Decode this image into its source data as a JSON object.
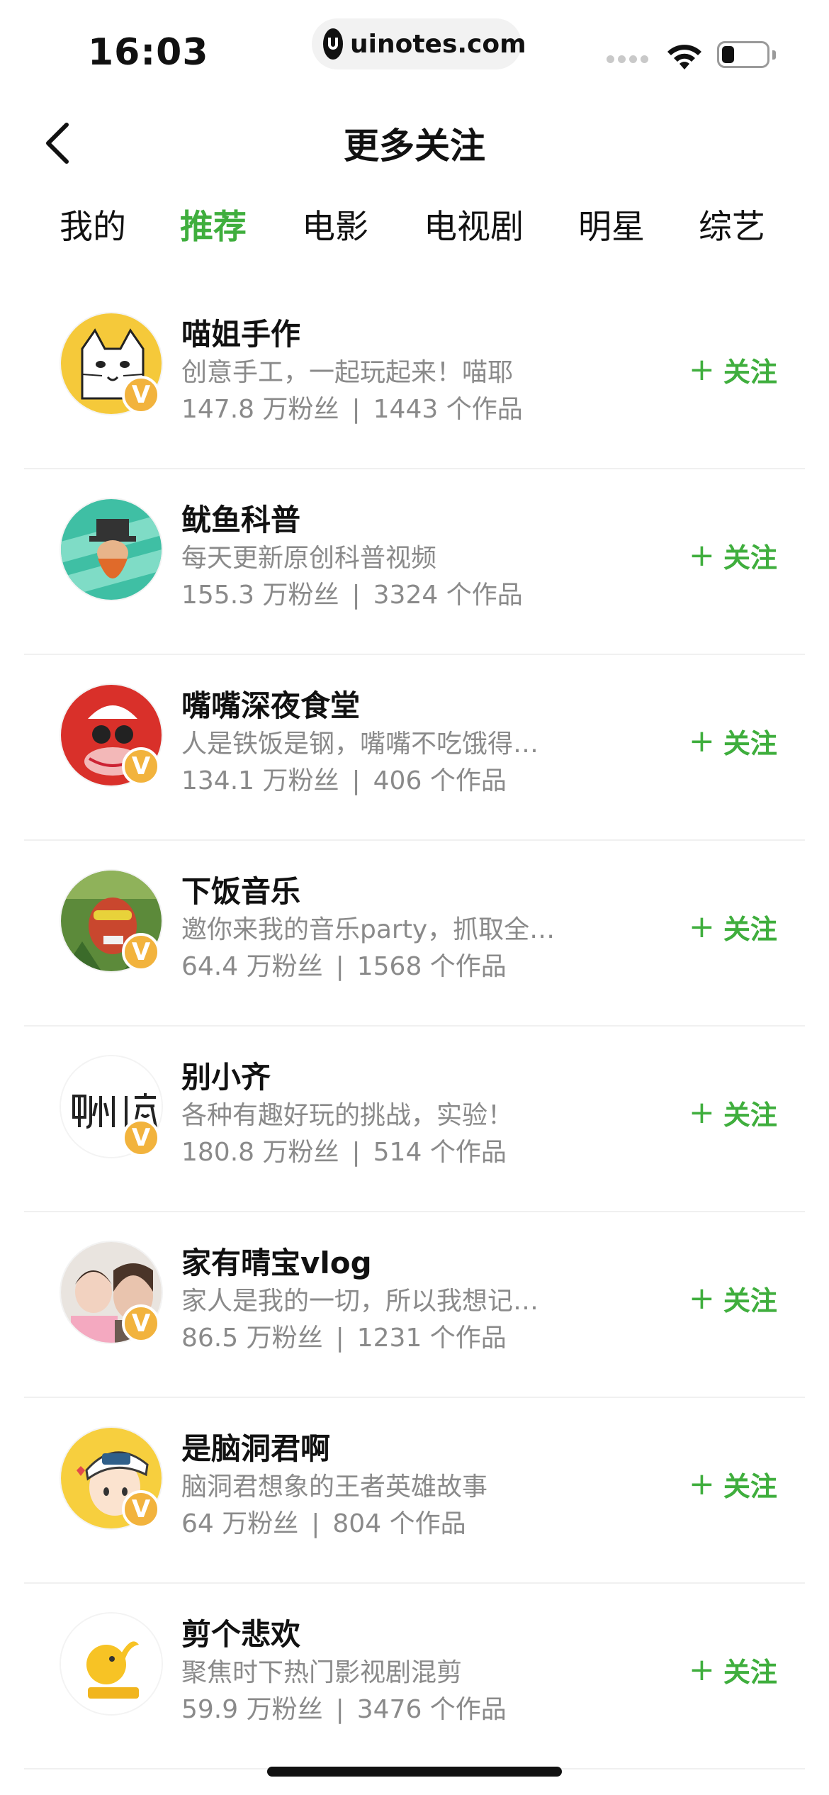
{
  "status_bar": {
    "time": "16:03",
    "url": "uinotes.com",
    "icons": [
      "signal-icon",
      "wifi-icon",
      "battery-icon"
    ]
  },
  "header": {
    "title": "更多关注",
    "back_icon": "chevron-left-icon"
  },
  "tabs": [
    {
      "label": "我的",
      "active": false
    },
    {
      "label": "推荐",
      "active": true
    },
    {
      "label": "电影",
      "active": false
    },
    {
      "label": "电视剧",
      "active": false
    },
    {
      "label": "明星",
      "active": false
    },
    {
      "label": "综艺",
      "active": false
    }
  ],
  "follow_label": "关注",
  "accounts": [
    {
      "name": "喵姐手作",
      "desc": "创意手工，一起玩起来！喵耶",
      "fans": "147.8 万粉丝",
      "works": "1443 个作品",
      "verified": true
    },
    {
      "name": "鱿鱼科普",
      "desc": "每天更新原创科普视频",
      "fans": "155.3 万粉丝",
      "works": "3324 个作品",
      "verified": false
    },
    {
      "name": "嘴嘴深夜食堂",
      "desc": "人是铁饭是钢，嘴嘴不吃饿得…",
      "fans": "134.1 万粉丝",
      "works": "406 个作品",
      "verified": true
    },
    {
      "name": "下饭音乐",
      "desc": "邀你来我的音乐party，抓取全…",
      "fans": "64.4 万粉丝",
      "works": "1568 个作品",
      "verified": true
    },
    {
      "name": "别小齐",
      "desc": "各种有趣好玩的挑战，实验！",
      "fans": "180.8 万粉丝",
      "works": "514 个作品",
      "verified": true
    },
    {
      "name": "家有晴宝vlog",
      "desc": "家人是我的一切，所以我想记…",
      "fans": "86.5 万粉丝",
      "works": "1231 个作品",
      "verified": true
    },
    {
      "name": "是脑洞君啊",
      "desc": "脑洞君想象的王者英雄故事",
      "fans": "64 万粉丝",
      "works": "804 个作品",
      "verified": true
    },
    {
      "name": "剪个悲欢",
      "desc": "聚焦时下热门影视剧混剪",
      "fans": "59.9 万粉丝",
      "works": "3476 个作品",
      "verified": false
    }
  ],
  "colors": {
    "accent": "#3fae3d",
    "text_primary": "#111111",
    "text_secondary": "#8a8a8a",
    "badge": "#f2b33d"
  }
}
